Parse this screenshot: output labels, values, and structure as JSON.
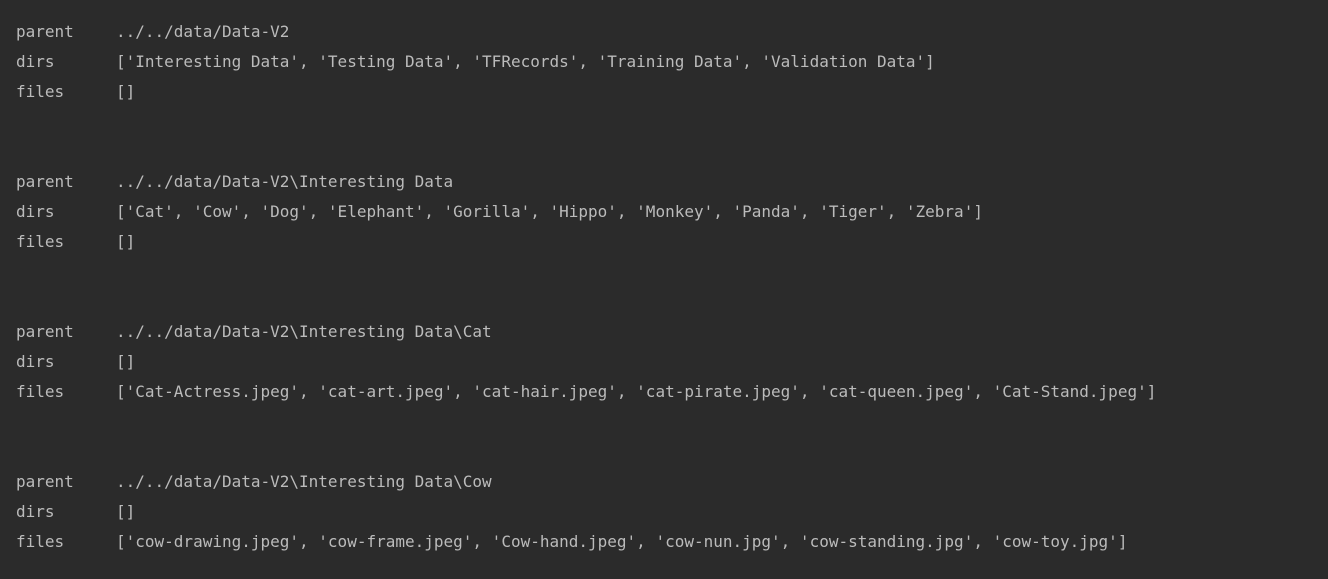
{
  "entries": [
    {
      "parent_label": "parent",
      "parent": "../../data/Data-V2",
      "dirs_label": "dirs",
      "dirs": "['Interesting Data', 'Testing Data', 'TFRecords', 'Training Data', 'Validation Data']",
      "files_label": "files",
      "files": "[]"
    },
    {
      "parent_label": "parent",
      "parent": "../../data/Data-V2\\Interesting Data",
      "dirs_label": "dirs",
      "dirs": "['Cat', 'Cow', 'Dog', 'Elephant', 'Gorilla', 'Hippo', 'Monkey', 'Panda', 'Tiger', 'Zebra']",
      "files_label": "files",
      "files": "[]"
    },
    {
      "parent_label": "parent",
      "parent": "../../data/Data-V2\\Interesting Data\\Cat",
      "dirs_label": "dirs",
      "dirs": "[]",
      "files_label": "files",
      "files": "['Cat-Actress.jpeg', 'cat-art.jpeg', 'cat-hair.jpeg', 'cat-pirate.jpeg', 'cat-queen.jpeg', 'Cat-Stand.jpeg']"
    },
    {
      "parent_label": "parent",
      "parent": "../../data/Data-V2\\Interesting Data\\Cow",
      "dirs_label": "dirs",
      "dirs": "[]",
      "files_label": "files",
      "files": "['cow-drawing.jpeg', 'cow-frame.jpeg', 'Cow-hand.jpeg', 'cow-nun.jpg', 'cow-standing.jpg', 'cow-toy.jpg']"
    }
  ],
  "colors": {
    "background": "#2b2b2b",
    "text": "#bbbbbb"
  }
}
